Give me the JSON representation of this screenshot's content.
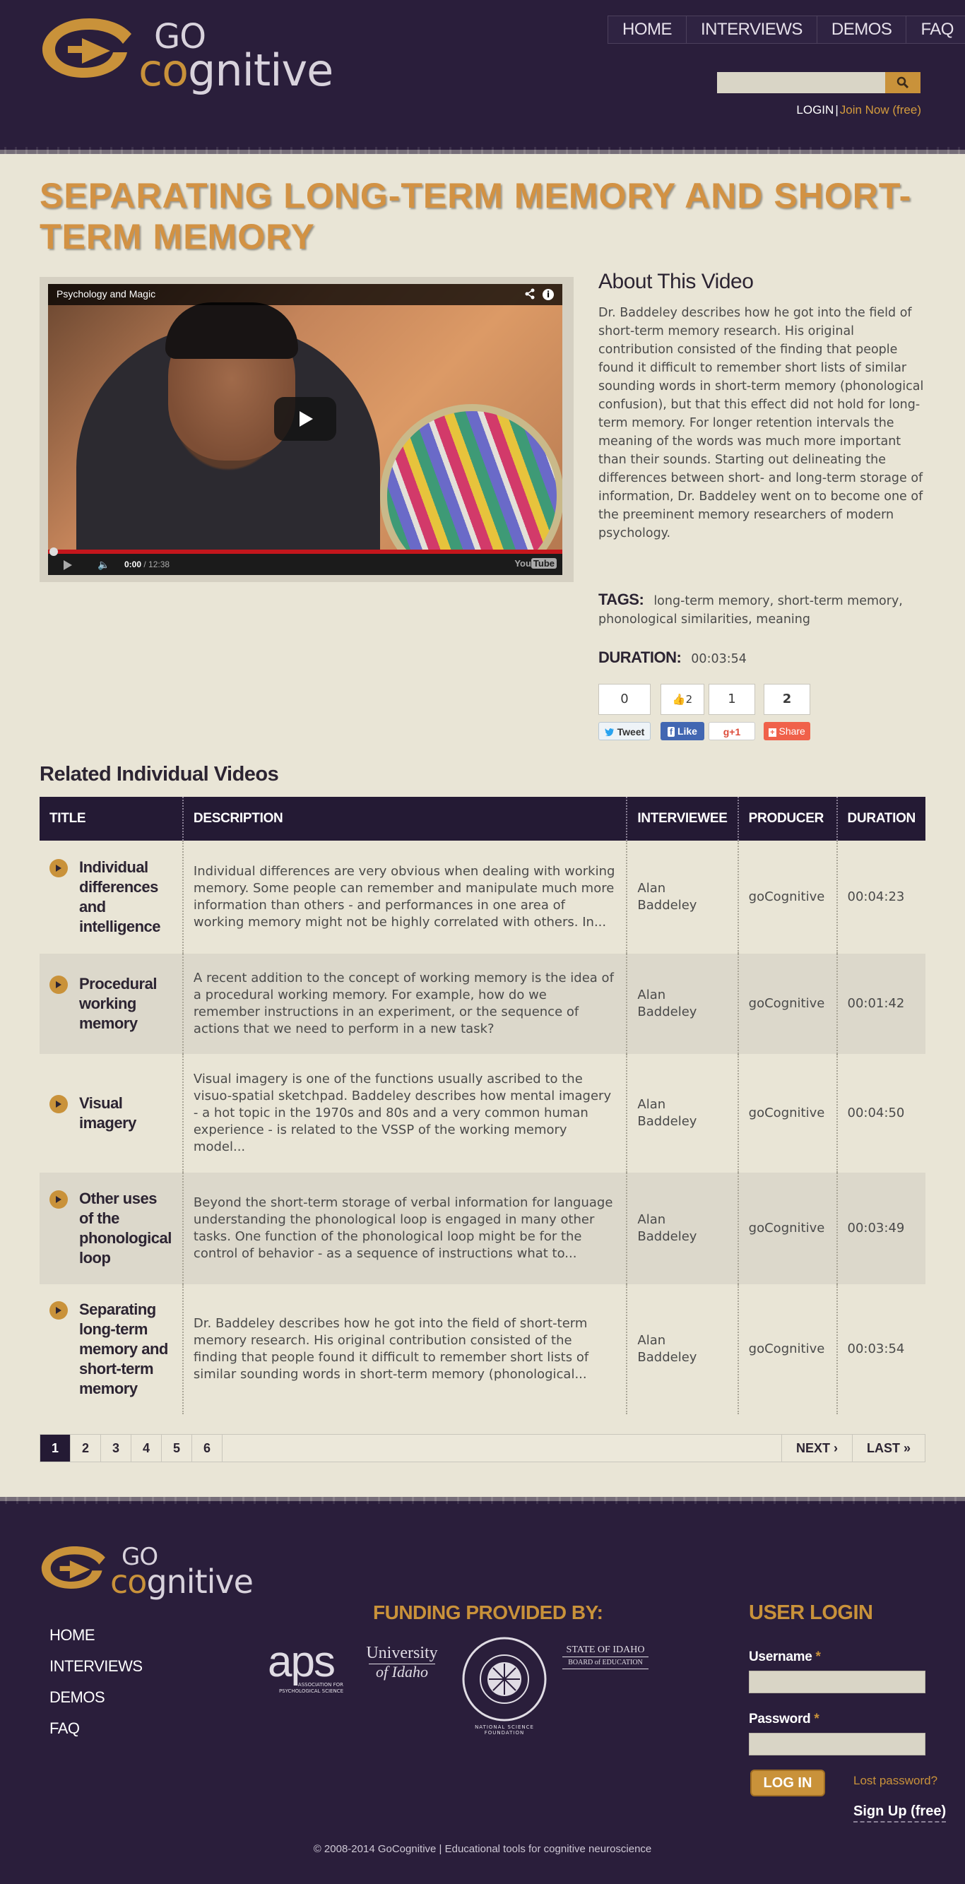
{
  "header": {
    "logo_go": "GO",
    "logo_co": "co",
    "logo_rest": "gnitive",
    "nav": [
      "HOME",
      "INTERVIEWS",
      "DEMOS",
      "FAQ"
    ],
    "search_placeholder": "",
    "login": "LOGIN",
    "separator": "|",
    "join": "Join Now (free)"
  },
  "page": {
    "title": "SEPARATING LONG-TERM MEMORY AND SHORT-TERM MEMORY"
  },
  "video": {
    "title": "Psychology and Magic",
    "time_current": "0:00",
    "time_total": " / 12:38",
    "brand": "You",
    "brand_tube": "Tube",
    "icons": [
      "share-icon",
      "info-icon",
      "play-icon",
      "volume-icon",
      "settings-icon"
    ]
  },
  "about": {
    "heading": "About This Video",
    "description": "Dr. Baddeley describes how he got into the field of short-term memory research. His original contribution consisted of the finding that people found it difficult to remember short lists of similar sounding words in short-term memory (phonological confusion), but that this effect did not hold for long-term memory. For longer retention intervals the meaning of the words was much more important than their sounds. Starting out delineating the differences between short- and long-term storage of information, Dr. Baddeley went on to become one of the preeminent memory researchers of modern psychology.",
    "tags_label": "TAGS:",
    "tags": "long-term memory, short-term memory, phonological similarities, meaning",
    "duration_label": "DURATION:",
    "duration": "00:03:54"
  },
  "social": {
    "tweet_count": "0",
    "tweet_label": "Tweet",
    "like_count": "2",
    "like_label": "Like",
    "gplus_count": "1",
    "gplus_label": "+1",
    "share_count": "2",
    "share_label": "Share"
  },
  "related": {
    "heading": "Related Individual Videos",
    "columns": [
      "TITLE",
      "DESCRIPTION",
      "INTERVIEWEE",
      "PRODUCER",
      "DURATION"
    ],
    "rows": [
      {
        "title": "Individual differences and intelligence",
        "description": "Individual differences are very obvious when dealing with working memory. Some people can remember and manipulate much more information than others - and performances in one area of working memory might not be highly correlated with others. In...",
        "interviewee": "Alan Baddeley",
        "producer": "goCognitive",
        "duration": "00:04:23"
      },
      {
        "title": "Procedural working memory",
        "description": "A recent addition to the concept of working memory is the idea of a procedural working memory. For example, how do we remember instructions in an experiment, or the sequence of actions that we need to perform in a new task?",
        "interviewee": "Alan Baddeley",
        "producer": "goCognitive",
        "duration": "00:01:42"
      },
      {
        "title": "Visual imagery",
        "description": "Visual imagery is one of the functions usually ascribed to the visuo-spatial sketchpad. Baddeley describes how mental imagery - a hot topic in the 1970s and 80s and a very common human experience - is related to the VSSP of the working memory model...",
        "interviewee": "Alan Baddeley",
        "producer": "goCognitive",
        "duration": "00:04:50"
      },
      {
        "title": "Other uses of the phonological loop",
        "description": "Beyond the short-term storage of verbal information for language understanding the phonological loop is engaged in many other tasks. One function of the phonological loop might be for the control of behavior - as a sequence of instructions what to...",
        "interviewee": "Alan Baddeley",
        "producer": "goCognitive",
        "duration": "00:03:49"
      },
      {
        "title": "Separating long-term memory and short-term memory",
        "description": "Dr. Baddeley describes how he got into the field of short-term memory research. His original contribution consisted of the finding that people found it difficult to remember short lists of similar sounding words in short-term memory (phonological...",
        "interviewee": "Alan Baddeley",
        "producer": "goCognitive",
        "duration": "00:03:54"
      }
    ]
  },
  "pager": {
    "pages": [
      "1",
      "2",
      "3",
      "4",
      "5",
      "6"
    ],
    "active": "1",
    "next": "NEXT ›",
    "last": "LAST »"
  },
  "footer": {
    "nav": [
      "HOME",
      "INTERVIEWS",
      "DEMOS",
      "FAQ"
    ],
    "funding_title": "FUNDING PROVIDED BY:",
    "aps": "aps",
    "aps_sub": "ASSOCIATION FOR\nPSYCHOLOGICAL SCIENCE",
    "uidaho_1": "University",
    "uidaho_2": "of Idaho",
    "nsf": "NATIONAL SCIENCE FOUNDATION",
    "idaho_board_1": "STATE OF IDAHO",
    "idaho_board_2": "BOARD of EDUCATION",
    "login_title": "USER LOGIN",
    "username_label": "Username",
    "password_label": "Password",
    "required": "*",
    "login_button": "LOG IN",
    "lost_password": "Lost password?",
    "signup": "Sign Up (free)",
    "copyright": "© 2008-2014 GoCognitive | Educational tools for cognitive neuroscience"
  },
  "colors": {
    "purple": "#2a1e3b",
    "gold": "#c9923a",
    "title_orange": "#d29244",
    "background": "#e9e5d6"
  }
}
